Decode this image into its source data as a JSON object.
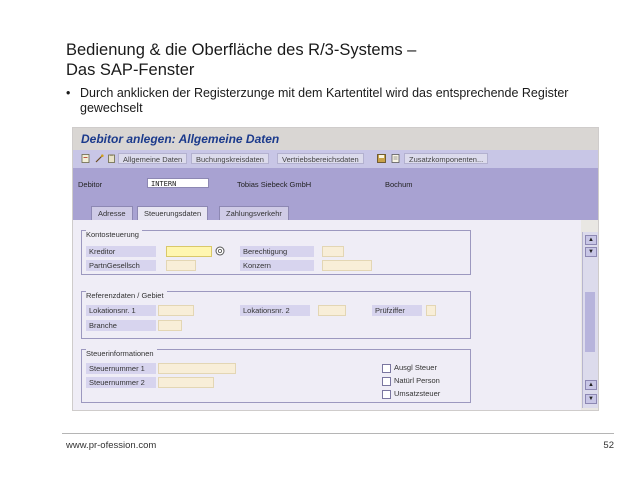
{
  "slide": {
    "title_line1": "Bedienung & die Oberfläche des R/3-Systems –",
    "title_line2": "Das SAP-Fenster",
    "bullet_symbol": "•",
    "bullet": "Durch anklicken der Registerzunge mit dem Kartentitel wird das entsprechende Register gewechselt",
    "footer_url": "www.pr-ofession.com",
    "page_number": "52"
  },
  "sap": {
    "window_title": "Debitor anlegen: Allgemeine Daten",
    "toolbar": {
      "btn_general": "Allgemeine Daten",
      "btn_company_code": "Buchungskreisdaten",
      "btn_sales": "Vertriebsbereichsdaten",
      "btn_additional": "Zusatzkomponenten..."
    },
    "header": {
      "debitor_label": "Debitor",
      "debitor_value": "INTERN",
      "company": "Tobias Siebeck GmbH",
      "city": "Bochum"
    },
    "tabs": [
      "Adresse",
      "Steuerungsdaten",
      "Zahlungsverkehr"
    ],
    "kontosteuerung": {
      "title": "Kontosteuerung",
      "kreditor": "Kreditor",
      "partngesellsch": "PartnGesellsch",
      "berechtigung": "Berechtigung",
      "konzern": "Konzern"
    },
    "referenzdaten": {
      "title": "Referenzdaten / Gebiet",
      "lokationsnr1": "Lokationsnr. 1",
      "branche": "Branche",
      "lokationsnr2": "Lokationsnr. 2",
      "pruefziffer": "Prüfziffer"
    },
    "steuer": {
      "title": "Steuerinformationen",
      "nummer1": "Steuernummer 1",
      "nummer2": "Steuernummer 2",
      "ausgl": "Ausgl Steuer",
      "natuerl": "Natürl Person",
      "umsatz": "Umsatzsteuer"
    }
  }
}
